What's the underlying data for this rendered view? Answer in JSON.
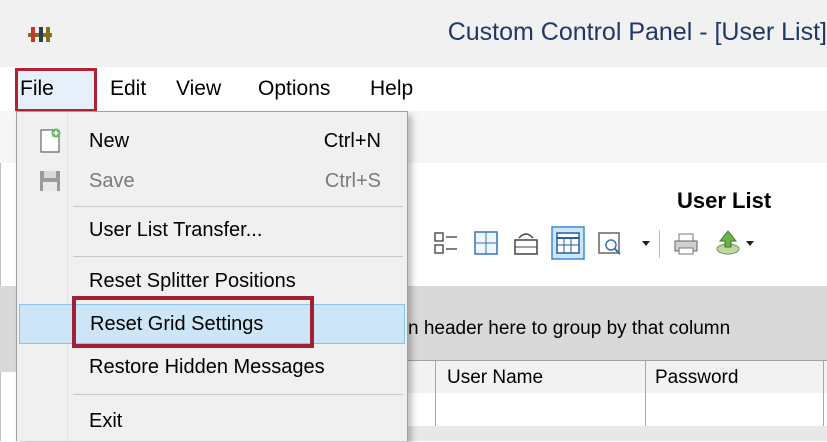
{
  "window": {
    "title": "Custom Control Panel - [User List]"
  },
  "menubar": {
    "items": [
      {
        "id": "file",
        "label": "File"
      },
      {
        "id": "edit",
        "label": "Edit"
      },
      {
        "id": "view",
        "label": "View"
      },
      {
        "id": "options",
        "label": "Options"
      },
      {
        "id": "help",
        "label": "Help"
      }
    ]
  },
  "file_menu": {
    "new": {
      "label": "New",
      "shortcut": "Ctrl+N",
      "icon": "new-document-icon"
    },
    "save": {
      "label": "Save",
      "shortcut": "Ctrl+S",
      "icon": "floppy-disk-icon",
      "disabled": true
    },
    "user_list_transfer": {
      "label": "User List Transfer..."
    },
    "reset_splitter": {
      "label": "Reset Splitter Positions"
    },
    "reset_grid": {
      "label": "Reset Grid Settings",
      "highlighted": true
    },
    "restore_hidden": {
      "label": "Restore Hidden Messages"
    },
    "exit": {
      "label": "Exit"
    }
  },
  "panel": {
    "title": "User List",
    "group_hint": "n header here to group by that column",
    "columns": [
      "User Name",
      "Password"
    ]
  },
  "colors": {
    "highlight_outline": "#a31f34",
    "hover_bg": "#cde6f7",
    "title_text": "#1f3864"
  }
}
